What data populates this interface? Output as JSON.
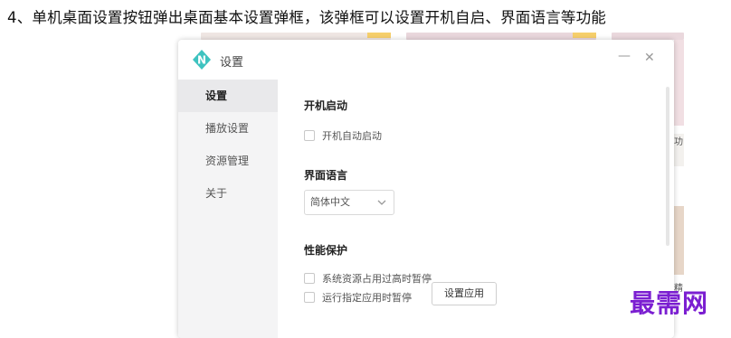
{
  "caption": "4、单机桌面设置按钮弹出桌面基本设置弹框，该弹框可以设置开机自启、界面语言等功能",
  "background": {
    "right_text_1": "功",
    "right_text_2": "精"
  },
  "dialog": {
    "title": "设置",
    "logo_letter": "N",
    "minimize_label": "—",
    "close_label": "✕"
  },
  "sidebar": {
    "items": [
      {
        "label": "设置",
        "active": true
      },
      {
        "label": "播放设置",
        "active": false
      },
      {
        "label": "资源管理",
        "active": false
      },
      {
        "label": "关于",
        "active": false
      }
    ]
  },
  "settings": {
    "startup": {
      "title": "开机启动",
      "checkbox_label": "开机自动启动",
      "checked": false
    },
    "language": {
      "title": "界面语言",
      "selected": "简体中文"
    },
    "performance": {
      "title": "性能保护",
      "option1": "系统资源占用过高时暂停",
      "option2": "运行指定应用时暂停",
      "option1_checked": false,
      "option2_checked": false,
      "button_label": "设置应用"
    }
  },
  "watermark": "最需网",
  "colors": {
    "logo": "#3ec3c0",
    "watermark": "#7b1fd1"
  }
}
